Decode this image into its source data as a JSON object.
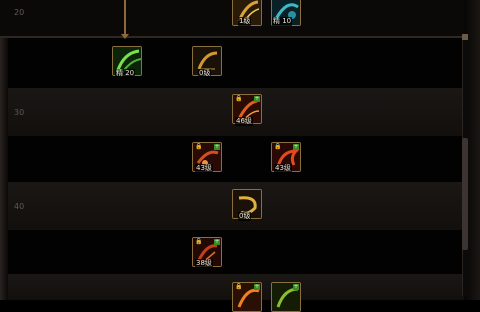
{
  "level_labels": [
    "20",
    "30",
    "40"
  ],
  "skills": [
    {
      "badge": "1级",
      "color": "#c8902a",
      "icon": "golden-slash-icon"
    },
    {
      "badge": "精 10",
      "color": "#2a8fa0",
      "icon": "cyan-wind-icon"
    },
    {
      "badge": "精 20",
      "color": "#4fb03a",
      "icon": "green-wind-icon"
    },
    {
      "badge": "0级",
      "color": "#b8862e",
      "icon": "golden-bow-icon"
    },
    {
      "badge": "46级",
      "color": "#b0451c",
      "icon": "fire-blade-icon"
    },
    {
      "badge": "43级",
      "color": "#a8461e",
      "icon": "red-strike-icon"
    },
    {
      "badge": "43级",
      "color": "#b23a1a",
      "icon": "red-dragon-icon"
    },
    {
      "badge": "0级",
      "color": "#c09030",
      "icon": "golden-arc-icon"
    },
    {
      "badge": "38级",
      "color": "#9a3c1c",
      "icon": "ember-strike-icon"
    },
    {
      "badge": "",
      "color": "#c8701e",
      "icon": "flame-burst-icon"
    },
    {
      "badge": "",
      "color": "#6a9a2a",
      "icon": "leaf-burst-icon"
    }
  ]
}
